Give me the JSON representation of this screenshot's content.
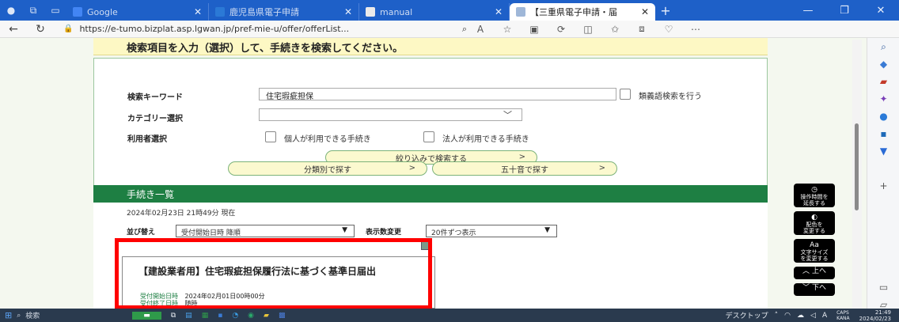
{
  "browser": {
    "tabs": [
      {
        "label": "Google",
        "color": "#4285f4"
      },
      {
        "label": "鹿児島県電子申請",
        "color": "#2b79d6"
      },
      {
        "label": "manual",
        "color": "#eaeaea"
      },
      {
        "label": "【三重県電子申請・届",
        "color": "#9fb7d8"
      }
    ],
    "url": "https://e-tumo.bizplat.asp.lgwan.jp/pref-mie-u/offer/offerList..."
  },
  "page": {
    "header": "検索項目を入力（選択）して、手続きを検索してください。",
    "search": {
      "keyword_label": "検索キーワード",
      "keyword_value": "住宅瑕疵担保",
      "synonym_label": "類義語検索を行う",
      "category_label": "カテゴリー選択",
      "user_label": "利用者選択",
      "individual_label": "個人が利用できる手続き",
      "corporate_label": "法人が利用できる手続き",
      "filter_button": "絞り込みで検索する"
    },
    "browse": {
      "by_category": "分類別で探す",
      "by_syllabary": "五十音で探す"
    },
    "list": {
      "title": "手続き一覧",
      "timestamp": "2024年02月23日 21時49分 現在",
      "sort_label": "並び替え",
      "sort_value": "受付開始日時 降順",
      "count_label": "表示数変更",
      "count_value": "20件ずつ表示",
      "card": {
        "title": "【建設業者用】住宅瑕疵担保履行法に基づく基準日届出",
        "start_label": "受付開始日時",
        "start_value": "2024年02月01日00時00分",
        "end_label": "受付終了日時",
        "end_value": "随時"
      }
    },
    "float_buttons": {
      "extend": [
        "操作時間を",
        "延長する"
      ],
      "color": [
        "配色を",
        "変更する"
      ],
      "text": [
        "文字サイズ",
        "を変更する"
      ],
      "up": "上へ",
      "down": "下へ"
    }
  },
  "taskbar": {
    "search_placeholder": "検索",
    "desktop": "デスクトップ",
    "ime": "A",
    "caps": "CAPS",
    "kana": "KANA",
    "time": "21:49",
    "date": "2024/02/23"
  }
}
